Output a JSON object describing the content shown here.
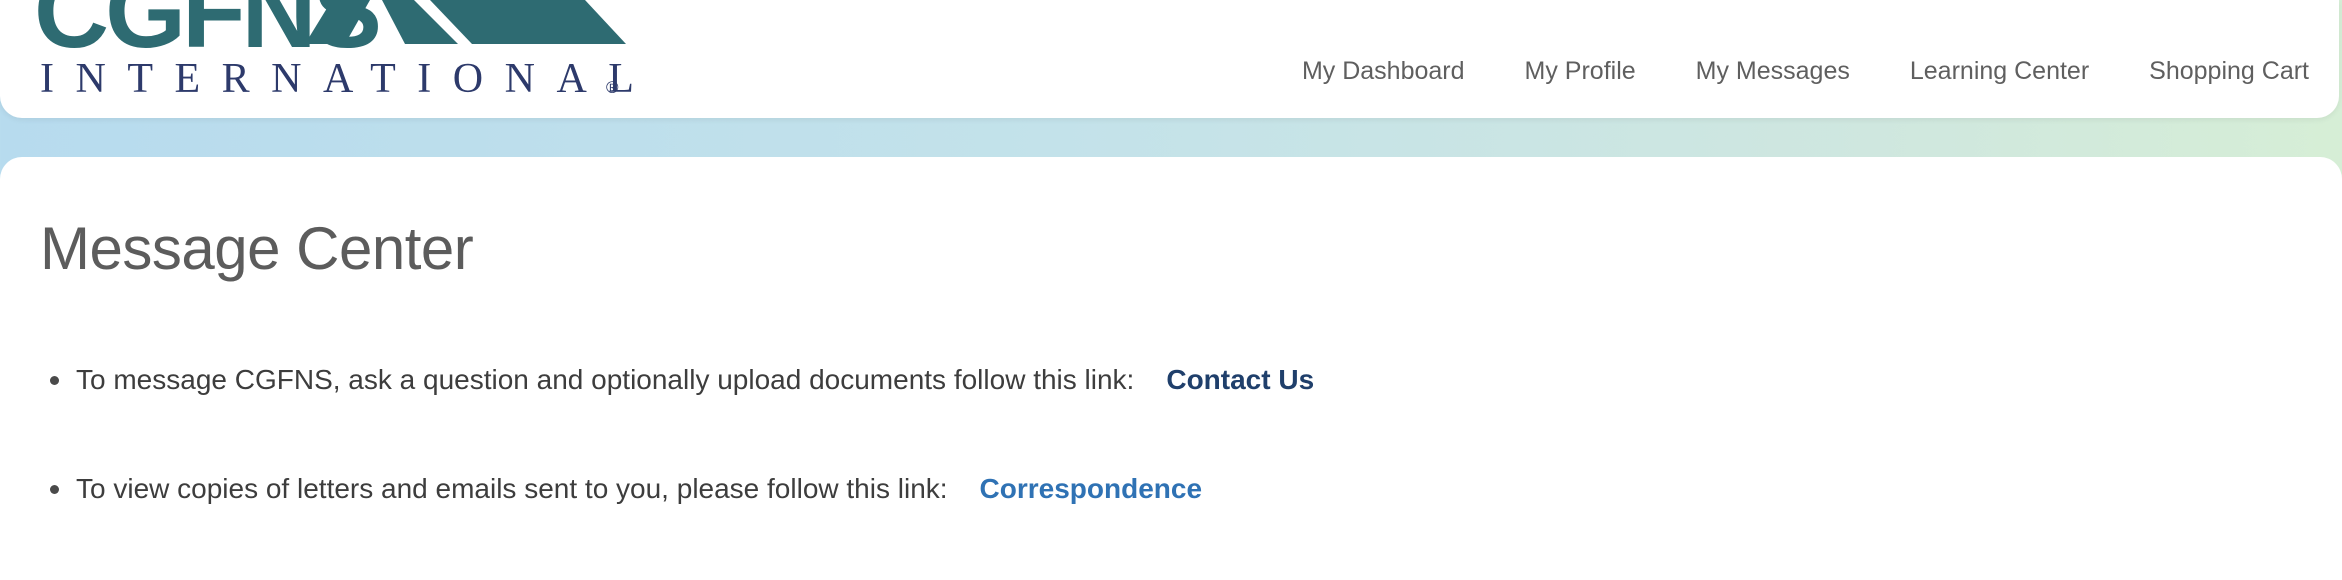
{
  "brand": {
    "logo_top": "CGFNS",
    "logo_bottom": "INTERNATIONAL",
    "logo_mark": "®",
    "color": "#2e6b72",
    "navy": "#2d3a6b"
  },
  "nav": {
    "items": [
      {
        "label": "My Dashboard"
      },
      {
        "label": "My Profile"
      },
      {
        "label": "My Messages"
      },
      {
        "label": "Learning Center"
      },
      {
        "label": "Shopping Cart"
      }
    ]
  },
  "main": {
    "title": "Message Center",
    "bullets": [
      {
        "text": "To message CGFNS, ask a question and optionally upload documents follow this link:",
        "link_label": "Contact Us",
        "link_color": "#1f3f6b"
      },
      {
        "text": "To view copies of letters and emails sent to you, please follow this link:",
        "link_label": "Correspondence",
        "link_color": "#2f72b4"
      }
    ]
  },
  "colors": {
    "bg_gradient_start": "#b7dbee",
    "bg_gradient_end": "#d6eed6",
    "nav_text": "#5f5f5f",
    "title_text": "#5c5c5c",
    "body_text": "#3d3d3d"
  }
}
